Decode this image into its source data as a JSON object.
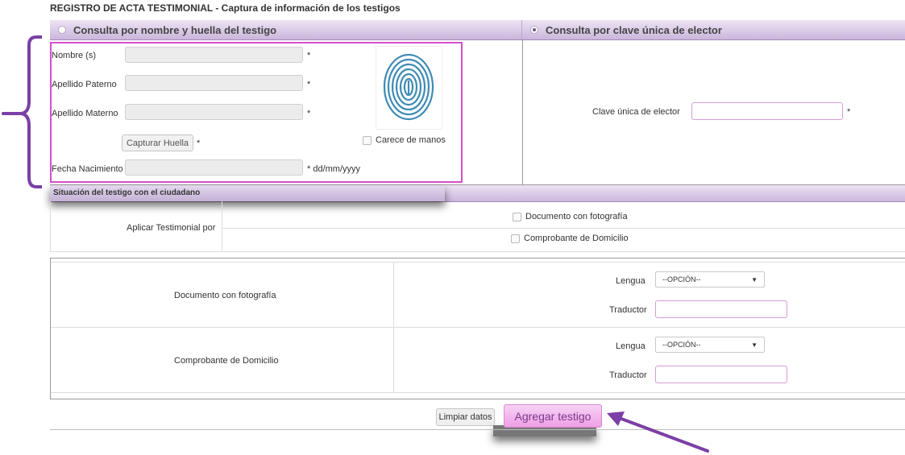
{
  "page": {
    "title": "REGISTRO DE ACTA TESTIMONIAL - Captura de información de los testigos"
  },
  "tabs": {
    "left": "Consulta por nombre y huella del testigo",
    "right": "Consulta por clave única de elector"
  },
  "form": {
    "nombre_label": "Nombre (s)",
    "paterno_label": "Apellido Paterno",
    "materno_label": "Apellido Materno",
    "fecha_label": "Fecha Nacimiento",
    "required": "*",
    "fecha_hint": "* dd/mm/yyyy",
    "capturar_label": "Capturar Huella",
    "carece_label": "Carece de manos"
  },
  "clave": {
    "label": "Clave única de elector",
    "required": "*"
  },
  "situacion": {
    "header": "Situación del testigo con el ciudadano",
    "aplicar_label": "Aplicar Testimonial por",
    "opcion_doc": "Documento con fotografía",
    "opcion_comp": "Comprobante de Domicilio"
  },
  "docs": {
    "rows": [
      {
        "name": "Documento con fotografía",
        "lengua_label": "Lengua",
        "lengua_value": "--OPCIÓN--",
        "traductor_label": "Traductor"
      },
      {
        "name": "Comprobante de Domicilio",
        "lengua_label": "Lengua",
        "lengua_value": "--OPCIÓN--",
        "traductor_label": "Traductor"
      }
    ]
  },
  "actions": {
    "limpiar": "Limpiar datos",
    "agregar": "Agregar testigo"
  },
  "colors": {
    "highlight": "#d64fc8",
    "annotation": "#7b3fa6",
    "header_gradient_top": "#ece3f3",
    "header_gradient_bottom": "#cbb6dc"
  }
}
